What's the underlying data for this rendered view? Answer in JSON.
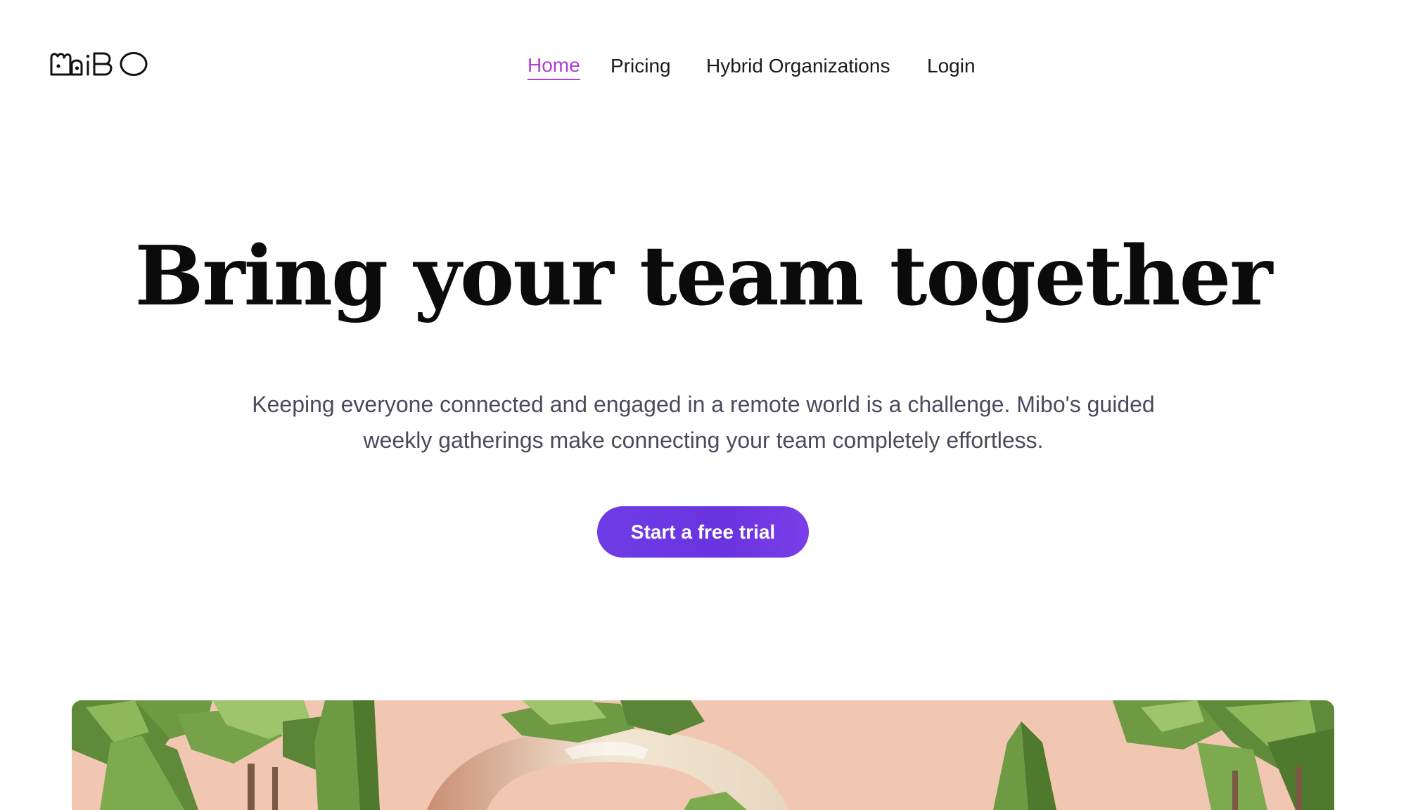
{
  "brand": {
    "logo_text": "MiBO"
  },
  "nav": {
    "items": [
      {
        "label": "Home",
        "active": true
      },
      {
        "label": "Pricing",
        "active": false
      },
      {
        "label": "Hybrid Organizations",
        "active": false
      },
      {
        "label": "Login",
        "active": false
      }
    ]
  },
  "hero": {
    "headline": "Bring your team together",
    "subtitle": "Keeping everyone connected and engaged in a remote world is a challenge. Mibo's guided weekly gatherings make connecting your team completely effortless.",
    "cta_label": "Start a free trial"
  },
  "colors": {
    "accent_nav_active": "#b040d8",
    "cta_purple": "#6e3ce6",
    "headline": "#0b0b0b",
    "subtitle": "#4a4a5c",
    "scene_background": "#f1c7b2"
  },
  "icons": {
    "logo": "mibo-logo-icon"
  }
}
